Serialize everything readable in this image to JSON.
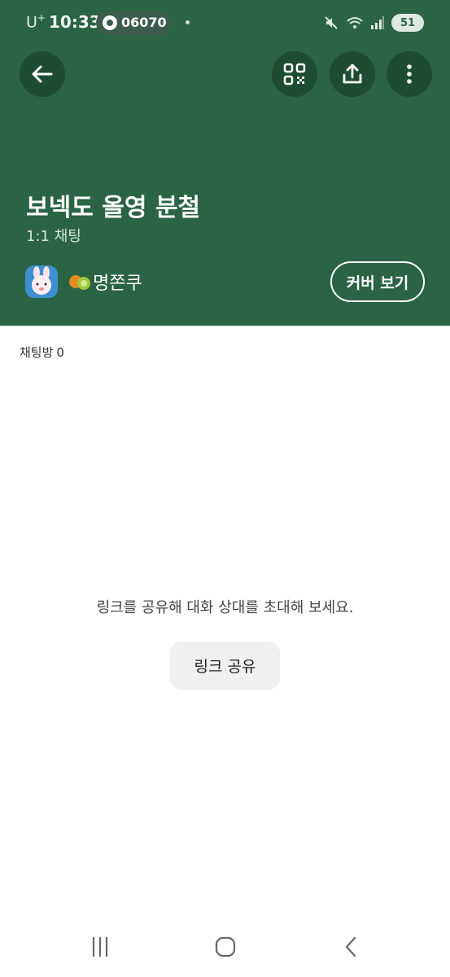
{
  "status_bar": {
    "carrier": "U",
    "carrier_sup": "+",
    "time": "10:33",
    "pill_text": "06070",
    "battery": "51"
  },
  "header": {
    "background_color": "#2a6444",
    "title": "보넥도 올영 분철",
    "subtitle": "1:1 채팅",
    "owner_name": "명쫀쿠",
    "cover_button": "커버 보기",
    "icons": [
      "back-arrow-icon",
      "qr-code-icon",
      "share-icon",
      "more-vertical-icon"
    ]
  },
  "body": {
    "chat_room_label": "채팅방",
    "chat_room_count": "0",
    "empty_message": "링크를 공유해 대화 상대를 초대해 보세요.",
    "share_button": "링크 공유"
  },
  "nav_bar": {
    "icons": [
      "recent-apps-icon",
      "home-icon",
      "nav-back-icon"
    ]
  }
}
